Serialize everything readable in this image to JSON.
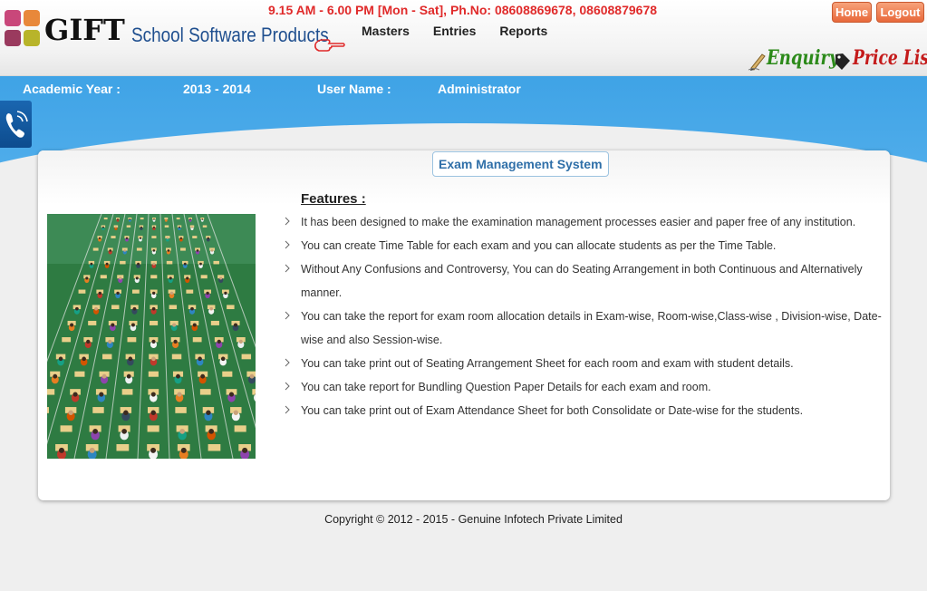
{
  "header": {
    "logo_main": "GIFT",
    "logo_sub": "School Software Products",
    "hours": "9.15 AM - 6.00 PM [Mon - Sat], Ph.No: 08608869678, 08608879678",
    "menu": [
      "Masters",
      "Entries",
      "Reports"
    ],
    "home_label": "Home",
    "logout_label": "Logout",
    "enquiry_label": "Enquiry",
    "pricelist_label": "Price List"
  },
  "infobar": {
    "year_label": "Academic Year :",
    "year_value": "2013 - 2014",
    "user_label": "User Name :",
    "user_value": "Administrator"
  },
  "main": {
    "title": "Exam Management System",
    "features_heading": "Features :",
    "features": [
      "It has been designed to make the examination management processes easier and paper free of any institution.",
      "You can create Time Table for each exam and you can allocate students as per the Time Table.",
      "Without Any Confusions and Controversy, You can do Seating Arrangement in both Continuous and Alternatively manner.",
      "You can take the report for exam room allocation details in Exam-wise, Room-wise,Class-wise , Division-wise, Date-wise and also Session-wise.",
      "You can take print out of Seating Arrangement Sheet for each room and exam with student details.",
      "You can take report for Bundling Question Paper Details for each exam and room.",
      "You can take print out of Exam Attendance Sheet for both Consolidate or Date-wise for the students."
    ]
  },
  "footer": {
    "copyright": "Copyright © 2012 - 2015 - Genuine Infotech Private Limited"
  },
  "colors": {
    "accent_blue": "#3fa3e6",
    "hours_red": "#e02a2a",
    "enquiry_green": "#2c8a1a",
    "pricelist_red": "#c41a1a",
    "button_orange": "#e8683a"
  },
  "icons": [
    "pointing-hand-icon",
    "pen-icon",
    "price-tag-icon",
    "phone-icon",
    "chevron-right-icon"
  ]
}
